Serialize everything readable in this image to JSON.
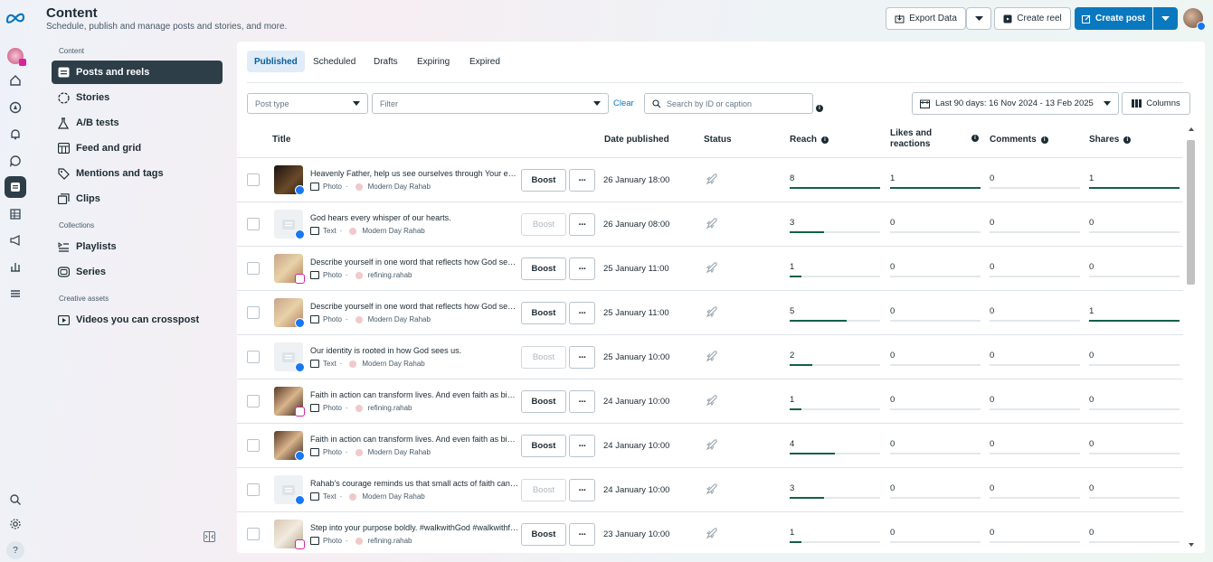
{
  "header": {
    "title": "Content",
    "subtitle": "Schedule, publish and manage posts and stories, and more.",
    "export_label": "Export Data",
    "create_reel_label": "Create reel",
    "create_post_label": "Create post"
  },
  "sidebar": {
    "section_content": "Content",
    "section_collections": "Collections",
    "section_creative": "Creative assets",
    "items": [
      {
        "label": "Posts and reels"
      },
      {
        "label": "Stories"
      },
      {
        "label": "A/B tests"
      },
      {
        "label": "Feed and grid"
      },
      {
        "label": "Mentions and tags"
      },
      {
        "label": "Clips"
      },
      {
        "label": "Playlists"
      },
      {
        "label": "Series"
      },
      {
        "label": "Videos you can crosspost"
      }
    ]
  },
  "tabs": [
    {
      "label": "Published"
    },
    {
      "label": "Scheduled"
    },
    {
      "label": "Drafts"
    },
    {
      "label": "Expiring"
    },
    {
      "label": "Expired"
    }
  ],
  "filters": {
    "post_type_placeholder": "Post type",
    "filter_placeholder": "Filter",
    "clear_label": "Clear",
    "search_placeholder": "Search by ID or caption",
    "date_range": "Last 90 days: 16 Nov 2024 - 13 Feb 2025",
    "columns_label": "Columns"
  },
  "table": {
    "headers": {
      "title": "Title",
      "date": "Date published",
      "status": "Status",
      "reach": "Reach",
      "likes_line1": "Likes and",
      "likes_line2": "reactions",
      "comments": "Comments",
      "shares": "Shares"
    },
    "rows": [
      {
        "caption": "Heavenly Father, help us see ourselves through Your eyes...",
        "type": "Photo",
        "account": "Modern Day Rahab",
        "platform": "facebook",
        "thumb": "dark",
        "boost": "Boost",
        "boost_enabled": true,
        "date": "26 January 18:00",
        "reach": "8",
        "likes": "1",
        "comments": "0",
        "shares": "1"
      },
      {
        "caption": "God hears every whisper of our hearts.",
        "type": "Text",
        "account": "Modern Day Rahab",
        "platform": "facebook",
        "thumb": "placeholder",
        "boost": "Boost",
        "boost_enabled": false,
        "date": "26 January 08:00",
        "reach": "3",
        "likes": "0",
        "comments": "0",
        "shares": "0"
      },
      {
        "caption": "Describe yourself in one word that reflects how God sees you",
        "type": "Photo",
        "account": "refining.rahab",
        "platform": "instagram",
        "thumb": "warm",
        "boost": "Boost",
        "boost_enabled": true,
        "date": "25 January 11:00",
        "reach": "1",
        "likes": "0",
        "comments": "0",
        "shares": "0"
      },
      {
        "caption": "Describe yourself in one word that reflects how God sees you",
        "type": "Photo",
        "account": "Modern Day Rahab",
        "platform": "facebook",
        "thumb": "warm",
        "boost": "Boost",
        "boost_enabled": true,
        "date": "25 January 11:00",
        "reach": "5",
        "likes": "0",
        "comments": "0",
        "shares": "1"
      },
      {
        "caption": "Our identity is rooted in how God sees us.",
        "type": "Text",
        "account": "Modern Day Rahab",
        "platform": "facebook",
        "thumb": "placeholder",
        "boost": "Boost",
        "boost_enabled": false,
        "date": "25 January 10:00",
        "reach": "2",
        "likes": "0",
        "comments": "0",
        "shares": "0"
      },
      {
        "caption": "Faith in action can transform lives. And even faith as big as a mustard seed",
        "type": "Photo",
        "account": "refining.rahab",
        "platform": "instagram",
        "thumb": "hands",
        "boost": "Boost",
        "boost_enabled": true,
        "date": "24 January 10:00",
        "reach": "1",
        "likes": "0",
        "comments": "0",
        "shares": "0"
      },
      {
        "caption": "Faith in action can transform lives. And even faith as big as a mustard seed",
        "type": "Photo",
        "account": "Modern Day Rahab",
        "platform": "facebook",
        "thumb": "hands",
        "boost": "Boost",
        "boost_enabled": true,
        "date": "24 January 10:00",
        "reach": "4",
        "likes": "0",
        "comments": "0",
        "shares": "0"
      },
      {
        "caption": "Rahab's courage reminds us that small acts of faith can change everything",
        "type": "Text",
        "account": "Modern Day Rahab",
        "platform": "facebook",
        "thumb": "placeholder",
        "boost": "Boost",
        "boost_enabled": false,
        "date": "24 January 10:00",
        "reach": "3",
        "likes": "0",
        "comments": "0",
        "shares": "0"
      },
      {
        "caption": "Step into your purpose boldly. #walkwithGod #walkwithfaith",
        "type": "Photo",
        "account": "refining.rahab",
        "platform": "instagram",
        "thumb": "light",
        "boost": "Boost",
        "boost_enabled": true,
        "date": "23 January 10:00",
        "reach": "1",
        "likes": "0",
        "comments": "0",
        "shares": "0"
      }
    ],
    "meta_separator": "·",
    "max_reach": 8,
    "max_likes": 1,
    "max_comments": 1,
    "max_shares": 1
  },
  "colors": {
    "accent": "#0a78be",
    "active_nav": "#2d3e48",
    "bar_fill": "#126047"
  }
}
